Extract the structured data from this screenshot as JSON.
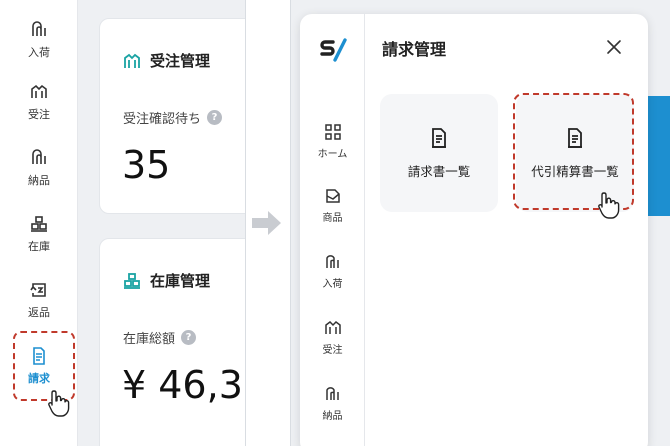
{
  "left": {
    "nav_items": [
      {
        "label": "入荷",
        "icon": "inbound-icon"
      },
      {
        "label": "受注",
        "icon": "order-icon"
      },
      {
        "label": "納品",
        "icon": "delivery-icon"
      },
      {
        "label": "在庫",
        "icon": "inventory-icon"
      },
      {
        "label": "返品",
        "icon": "return-icon"
      },
      {
        "label": "請求",
        "icon": "invoice-icon",
        "active": true
      }
    ],
    "card_order": {
      "title": "受注管理",
      "subtitle": "受注確認待ち",
      "value": "35"
    },
    "card_stock": {
      "title": "在庫管理",
      "subtitle": "在庫総額",
      "value": "¥ 46,3"
    },
    "help_glyph": "?"
  },
  "right": {
    "logo_icon": "brand-logo-icon",
    "nav_items": [
      {
        "label": "ホーム",
        "icon": "home-grid-icon"
      },
      {
        "label": "商品",
        "icon": "product-icon"
      },
      {
        "label": "入荷",
        "icon": "inbound-icon"
      },
      {
        "label": "受注",
        "icon": "order-icon"
      },
      {
        "label": "納品",
        "icon": "delivery-icon"
      }
    ],
    "modal_title": "請求管理",
    "tiles": [
      {
        "label": "請求書一覧",
        "icon": "document-icon"
      },
      {
        "label": "代引精算書一覧",
        "icon": "document-icon"
      }
    ]
  },
  "colors": {
    "accent": "#1d8fd0",
    "highlight": "#c0392b",
    "icon_teal": "#1aa3a3"
  }
}
